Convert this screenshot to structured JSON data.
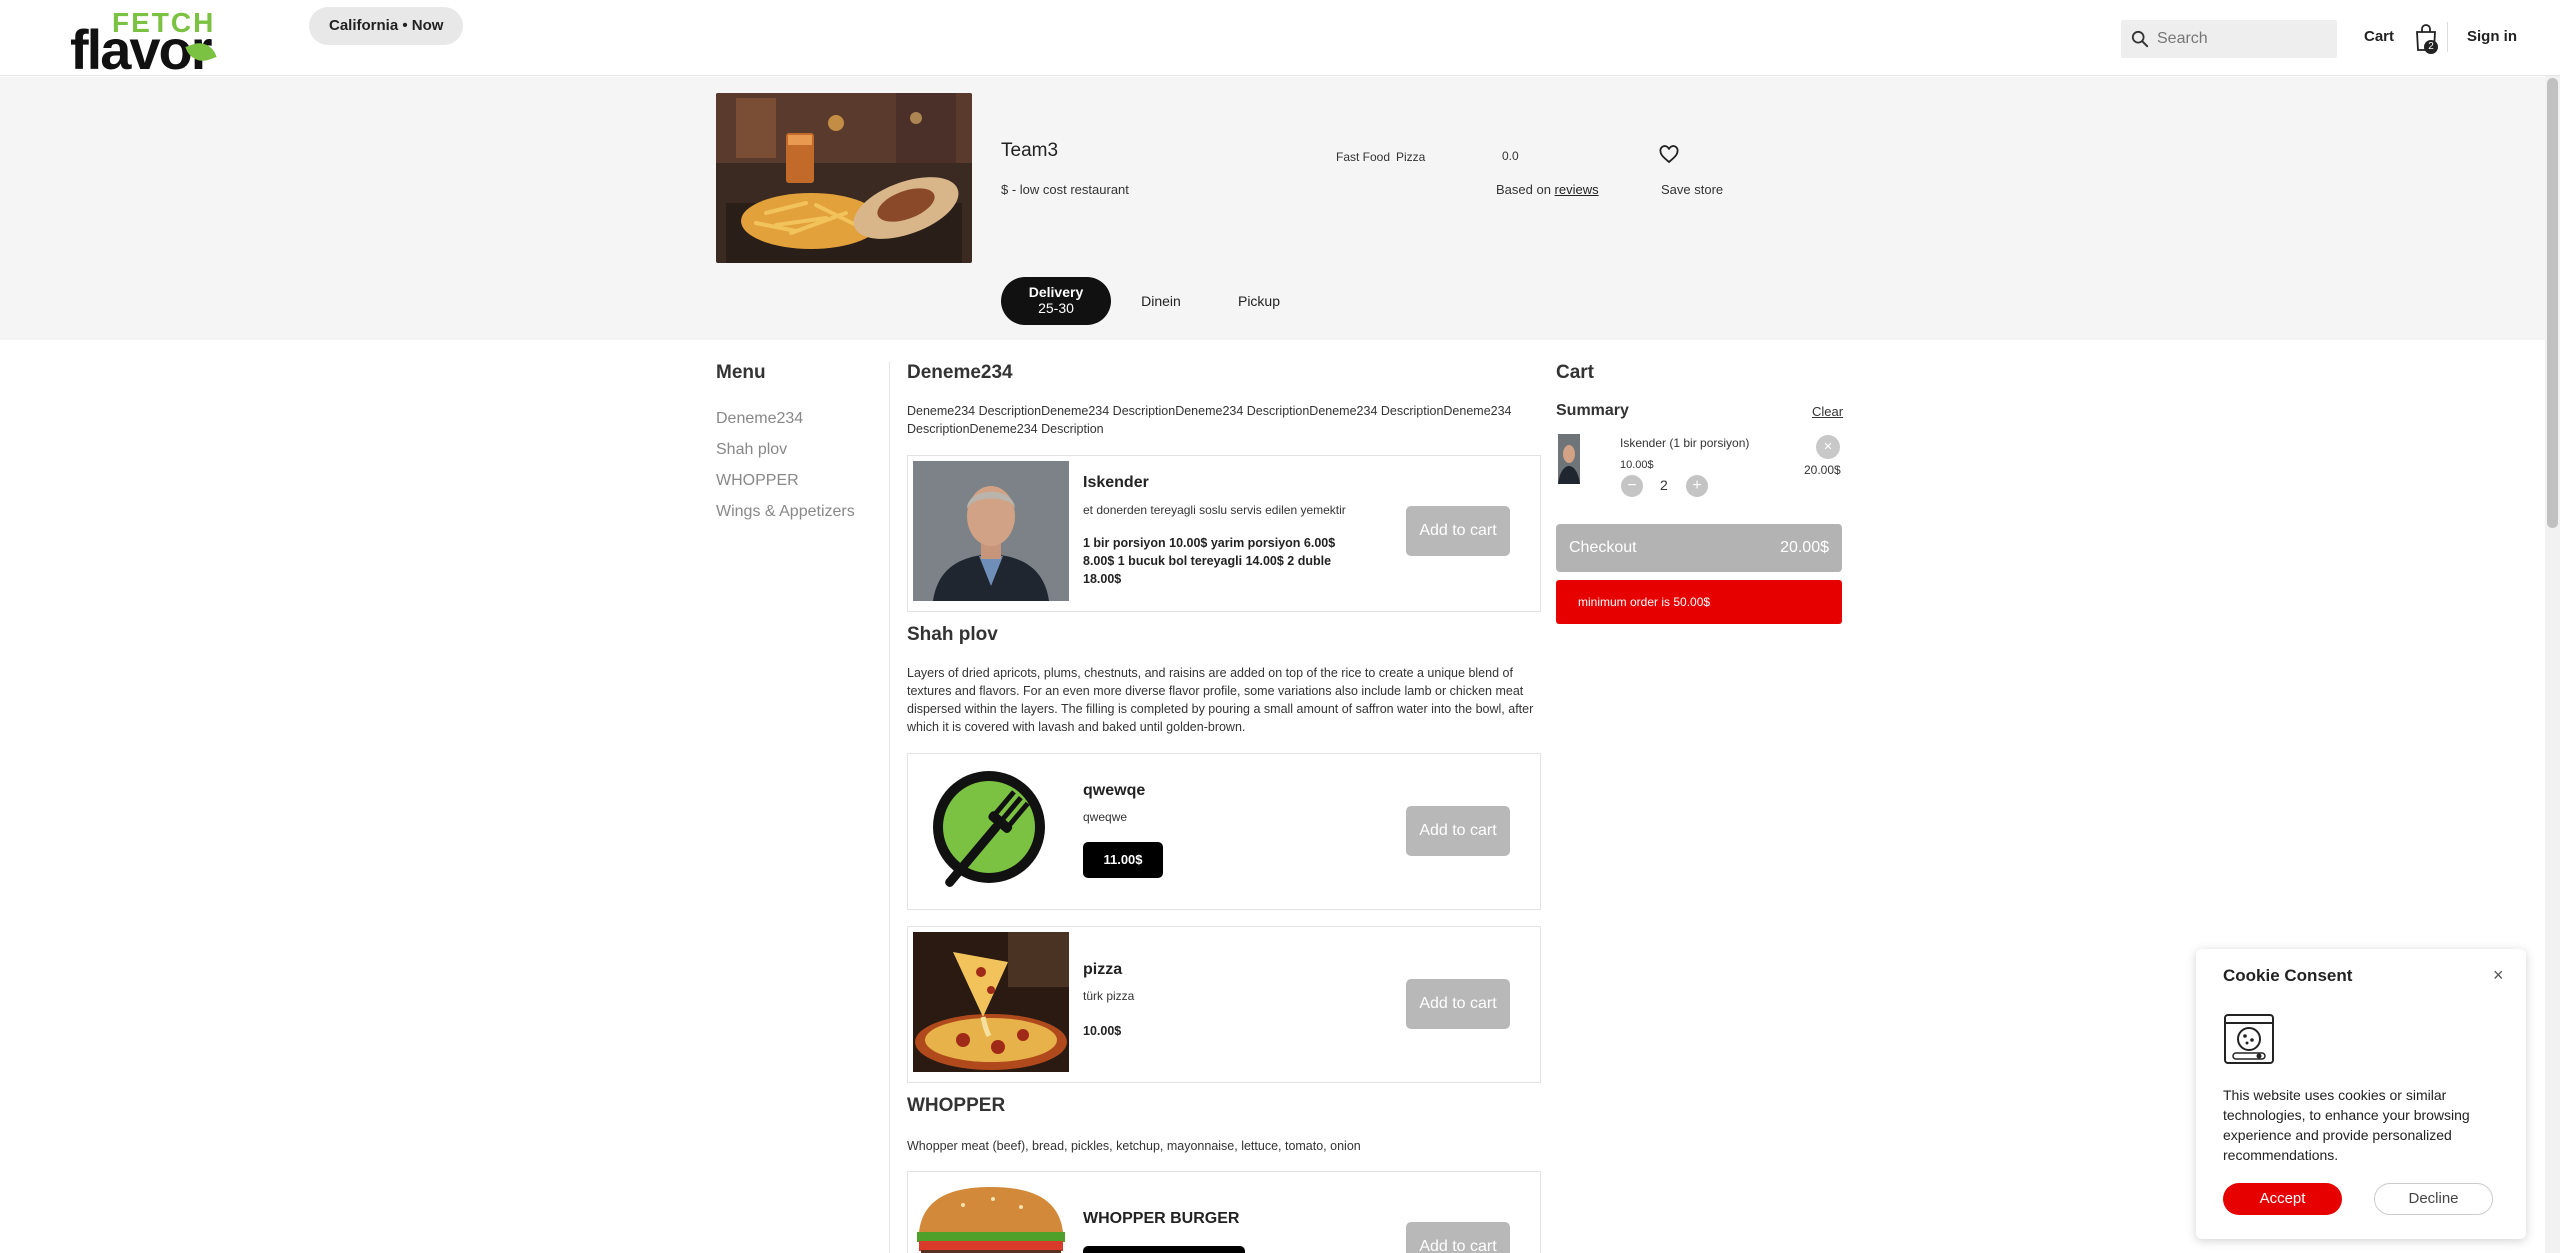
{
  "header": {
    "logo_top": "FETCH",
    "logo_bottom": "flavor",
    "location": "California • Now",
    "search_placeholder": "Search",
    "cart_label": "Cart",
    "cart_count": "2",
    "signin_label": "Sign in"
  },
  "store": {
    "name": "Team3",
    "price_level": "$ - low cost restaurant",
    "categories": [
      "Fast Food",
      "Pizza"
    ],
    "rating": "0.0",
    "based_on_prefix": "Based on ",
    "based_on_link": "reviews",
    "save_label": "Save store",
    "modes": [
      {
        "label": "Delivery",
        "sub": "25-30"
      },
      {
        "label": "Dinein"
      },
      {
        "label": "Pickup"
      }
    ]
  },
  "menu": {
    "title": "Menu",
    "links": [
      "Deneme234",
      "Shah plov",
      "WHOPPER",
      "Wings & Appetizers"
    ]
  },
  "sections": [
    {
      "title": "Deneme234",
      "description": "Deneme234 DescriptionDeneme234 DescriptionDeneme234 DescriptionDeneme234 DescriptionDeneme234 DescriptionDeneme234 Description",
      "items": [
        {
          "name": "Iskender",
          "description": "et donerden tereyagli soslu servis edilen yemektir",
          "prices": "1 bir porsiyon 10.00$   yarim porsiyon 6.00$ 8.00$   1 bucuk bol tereyagli 14.00$   2 duble 18.00$",
          "button": "Add to cart"
        }
      ]
    },
    {
      "title": "Shah plov",
      "description": "Layers of dried apricots, plums, chestnuts, and raisins are added on top of the rice to create a unique blend of textures and flavors. For an even more diverse flavor profile, some variations also include lamb or chicken meat dispersed within the layers. The filling is completed by pouring a small amount of saffron water into the bowl, after which it is covered with lavash and baked until golden-brown.",
      "items": [
        {
          "name": "qwewqe",
          "description": "qweqwe",
          "price": "11.00$",
          "button": "Add to cart"
        },
        {
          "name": "pizza",
          "description": "türk pizza",
          "price": "10.00$",
          "button": "Add to cart"
        }
      ]
    },
    {
      "title": "WHOPPER",
      "description": "Whopper meat (beef), bread, pickles, ketchup, mayonnaise, lettuce, tomato, onion",
      "items": [
        {
          "name": "WHOPPER BURGER",
          "button": "Add to cart"
        }
      ]
    }
  ],
  "cart": {
    "title": "Cart",
    "summary": "Summary",
    "clear": "Clear",
    "item_name": "Iskender (1 bir porsiyon)",
    "item_price": "10.00$",
    "item_qty": "2",
    "item_total": "20.00$",
    "checkout_label": "Checkout",
    "checkout_total": "20.00$",
    "min_order": "minimum order is 50.00$"
  },
  "cookie": {
    "title": "Cookie Consent",
    "text": "This website uses cookies or similar technologies, to enhance your browsing experience and provide personalized recommendations.",
    "accept": "Accept",
    "decline": "Decline"
  },
  "colors": {
    "brand_green": "#7cc242",
    "alert_red": "#e60000",
    "button_gray": "#b8b8b8"
  }
}
